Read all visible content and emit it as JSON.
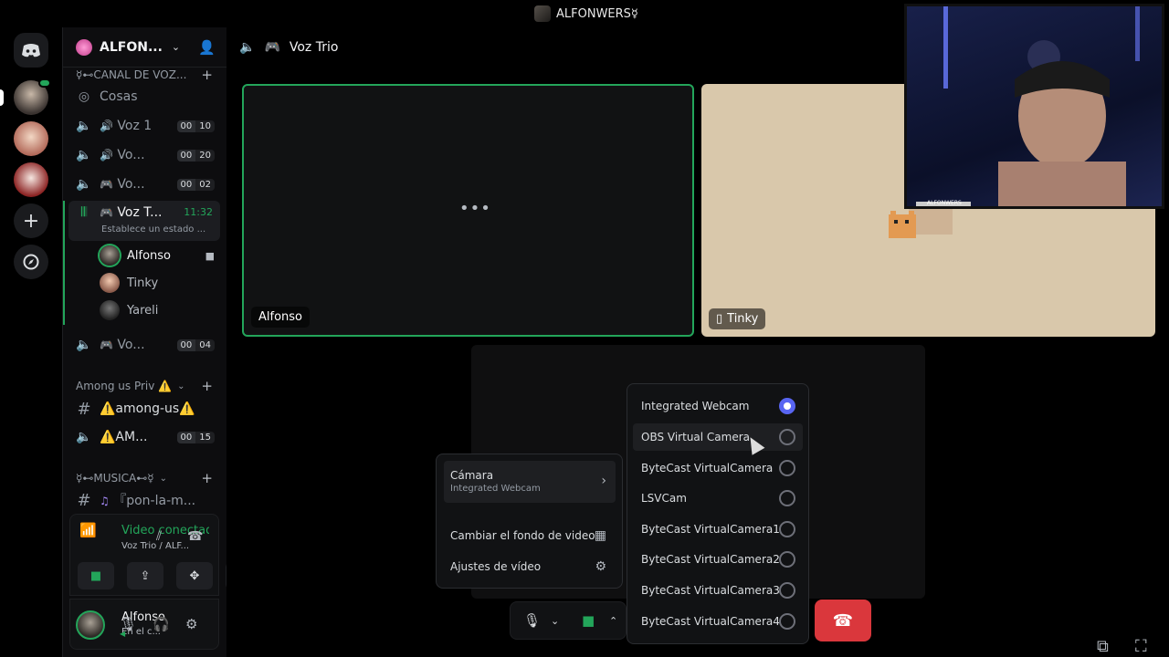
{
  "window": {
    "title": "ALFONWERS☿"
  },
  "server": {
    "name": "ALFON..."
  },
  "categories": {
    "voice": "☿⊷CANAL DE VOZ...",
    "among": "Among us Priv ⚠️",
    "music": "☿⊷MUSICA⊷☿"
  },
  "channels": [
    {
      "label": "Cosas"
    },
    {
      "label": "Voz 1",
      "c1": "00",
      "c2": "10"
    },
    {
      "label": "Vo...",
      "c1": "00",
      "c2": "20"
    },
    {
      "label": "Vo...",
      "c1": "00",
      "c2": "02"
    },
    {
      "label": "Voz T...",
      "timer": "11:32",
      "status": "Establece un estado ..."
    },
    {
      "label": "Vo...",
      "c1": "00",
      "c2": "04"
    },
    {
      "label": "⚠️among-us⚠️"
    },
    {
      "label": "⚠️AM...",
      "c1": "00",
      "c2": "15"
    },
    {
      "label": "『pon-la-m..."
    }
  ],
  "members": [
    "Alfonso",
    "Tinky",
    "Yareli"
  ],
  "voice_panel": {
    "status": "Video conectado",
    "sub": "Voz Trio / ALF..."
  },
  "user_panel": {
    "name": "Alfonso",
    "sub": "En el c..."
  },
  "main": {
    "channel_title": "Voz Trio"
  },
  "tiles": {
    "alfonso": "Alfonso",
    "tinky": "Tinky",
    "cat_tag": "ALFONWERS"
  },
  "menu": {
    "camera": "Cámara",
    "camera_sub": "Integrated Webcam",
    "background": "Cambiar el fondo de video",
    "settings": "Ajustes de vídeo"
  },
  "cameras": [
    "Integrated Webcam",
    "OBS Virtual Camera",
    "ByteCast VirtualCamera",
    "LSVCam",
    "ByteCast VirtualCamera1",
    "ByteCast VirtualCamera2",
    "ByteCast VirtualCamera3",
    "ByteCast VirtualCamera4"
  ],
  "selected_camera": "Integrated Webcam",
  "colors": {
    "accent_green": "#23a55a",
    "blurple": "#5865f2",
    "danger": "#da373c"
  }
}
